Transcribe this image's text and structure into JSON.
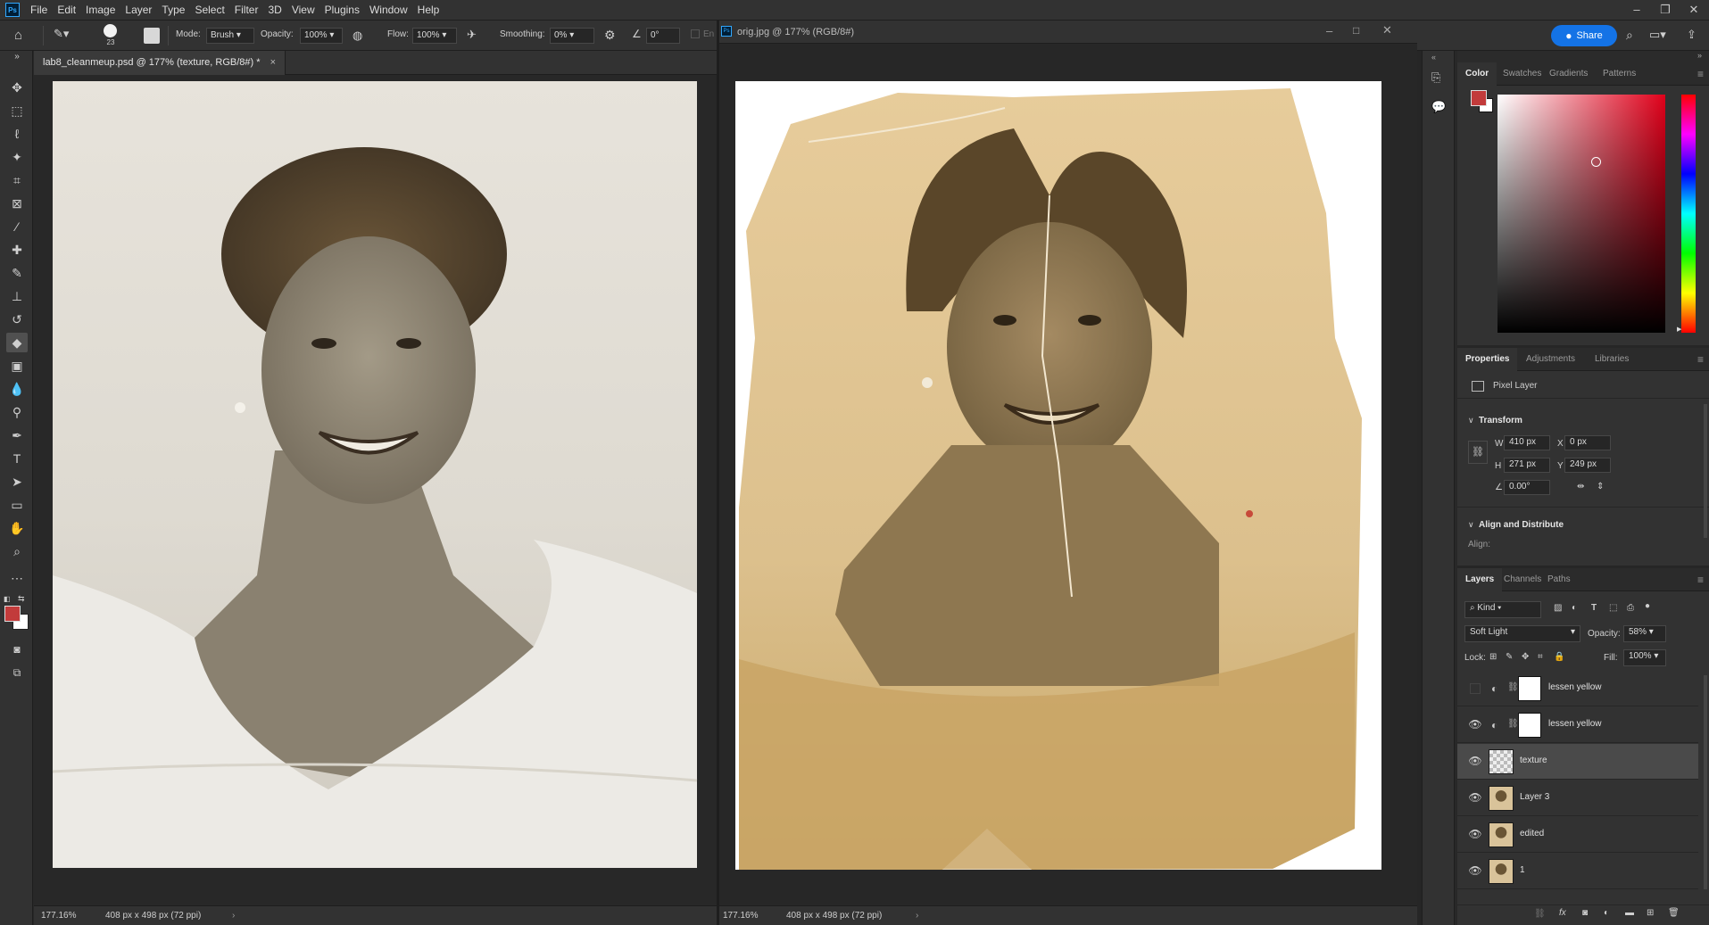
{
  "menubar": {
    "logo": "Ps",
    "items": [
      "File",
      "Edit",
      "Image",
      "Layer",
      "Type",
      "Select",
      "Filter",
      "3D",
      "View",
      "Plugins",
      "Window",
      "Help"
    ]
  },
  "options": {
    "brush_size": "23",
    "mode_label": "Mode:",
    "mode_value": "Brush",
    "opacity_label": "Opacity:",
    "opacity_value": "100%",
    "flow_label": "Flow:",
    "flow_value": "100%",
    "smoothing_label": "Smoothing:",
    "smoothing_value": "0%",
    "angle_value": "0°",
    "erase_history": "En",
    "share_label": "Share"
  },
  "doc_left": {
    "tab_title": "lab8_cleanmeup.psd @ 177% (texture, RGB/8#) *",
    "zoom": "177.16%",
    "dims": "408 px x 498 px (72 ppi)"
  },
  "doc_right": {
    "title": "orig.jpg @ 177% (RGB/8#)",
    "zoom": "177.16%",
    "dims": "408 px x 498 px (72 ppi)"
  },
  "color_panel": {
    "tabs": [
      "Color",
      "Swatches",
      "Gradients",
      "Patterns"
    ],
    "foreground": "#c23b3b",
    "background": "#ffffff"
  },
  "properties": {
    "tabs": [
      "Properties",
      "Adjustments",
      "Libraries"
    ],
    "layer_type": "Pixel Layer",
    "transform_label": "Transform",
    "w_label": "W",
    "w_value": "410 px",
    "x_label": "X",
    "x_value": "0 px",
    "h_label": "H",
    "h_value": "271 px",
    "y_label": "Y",
    "y_value": "249 px",
    "angle_value": "0.00°",
    "align_label": "Align and Distribute",
    "align_sub": "Align:"
  },
  "layers": {
    "tabs": [
      "Layers",
      "Channels",
      "Paths"
    ],
    "filter_kind": "Kind",
    "blend_mode": "Soft Light",
    "opacity_label": "Opacity:",
    "opacity_value": "58%",
    "lock_label": "Lock:",
    "fill_label": "Fill:",
    "fill_value": "100%",
    "items": [
      {
        "name": "lessen yellow",
        "visible": false,
        "type": "adjustment"
      },
      {
        "name": "lessen yellow",
        "visible": true,
        "type": "adjustment"
      },
      {
        "name": "texture",
        "visible": true,
        "type": "pixel",
        "selected": true
      },
      {
        "name": "Layer 3",
        "visible": true,
        "type": "photo"
      },
      {
        "name": "edited",
        "visible": true,
        "type": "photo"
      },
      {
        "name": "1",
        "visible": true,
        "type": "photo"
      }
    ]
  },
  "colors": {
    "accent": "#1473e6",
    "chrome": "#323232",
    "canvas_bg": "#282828"
  }
}
